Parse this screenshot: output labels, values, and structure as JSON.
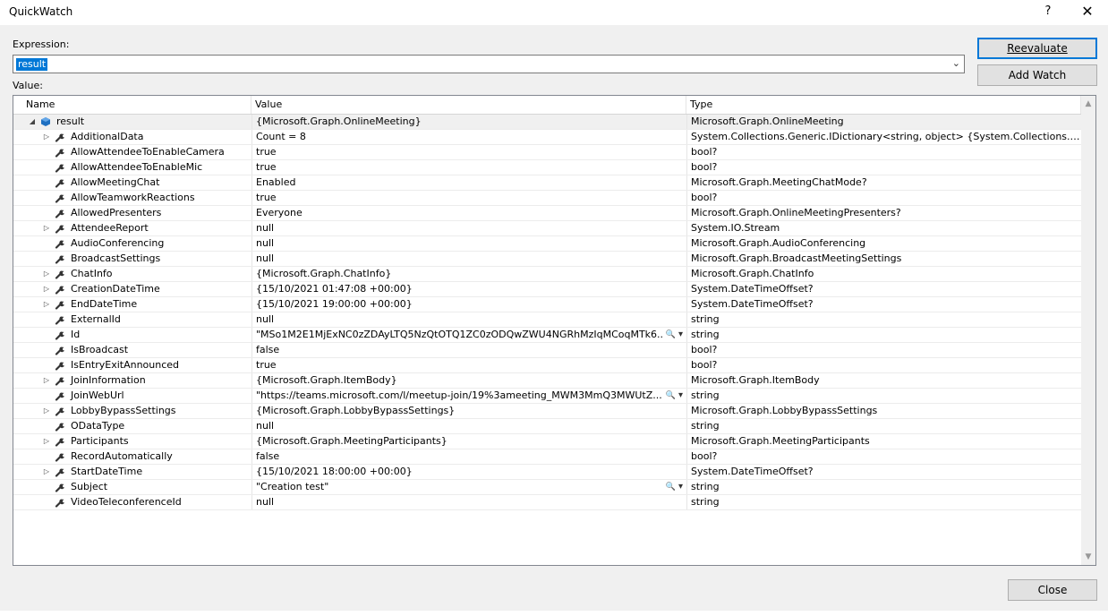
{
  "window": {
    "title": "QuickWatch",
    "help_label": "?",
    "close_label": "✕"
  },
  "expression": {
    "label": "Expression:",
    "value": "result"
  },
  "value_label": "Value:",
  "buttons": {
    "reevaluate": "Reevaluate",
    "add_watch": "Add Watch",
    "close": "Close"
  },
  "columns": {
    "name": "Name",
    "value": "Value",
    "type": "Type"
  },
  "rows": [
    {
      "name": "result",
      "value": "{Microsoft.Graph.OnlineMeeting}",
      "type": "Microsoft.Graph.OnlineMeeting",
      "expander": "collapse",
      "icon": "object-icon",
      "level": 0,
      "tools": false
    },
    {
      "name": "AdditionalData",
      "value": "Count = 8",
      "type": "System.Collections.Generic.IDictionary<string, object> {System.Collections.Gene...",
      "expander": "expand",
      "icon": "property-wrench-icon",
      "level": 1,
      "tools": false
    },
    {
      "name": "AllowAttendeeToEnableCamera",
      "value": "true",
      "type": "bool?",
      "expander": "",
      "icon": "property-wrench-icon",
      "level": 1,
      "tools": false
    },
    {
      "name": "AllowAttendeeToEnableMic",
      "value": "true",
      "type": "bool?",
      "expander": "",
      "icon": "property-wrench-icon",
      "level": 1,
      "tools": false
    },
    {
      "name": "AllowMeetingChat",
      "value": "Enabled",
      "type": "Microsoft.Graph.MeetingChatMode?",
      "expander": "",
      "icon": "property-wrench-icon",
      "level": 1,
      "tools": false
    },
    {
      "name": "AllowTeamworkReactions",
      "value": "true",
      "type": "bool?",
      "expander": "",
      "icon": "property-wrench-icon",
      "level": 1,
      "tools": false
    },
    {
      "name": "AllowedPresenters",
      "value": "Everyone",
      "type": "Microsoft.Graph.OnlineMeetingPresenters?",
      "expander": "",
      "icon": "property-wrench-icon",
      "level": 1,
      "tools": false
    },
    {
      "name": "AttendeeReport",
      "value": "null",
      "type": "System.IO.Stream",
      "expander": "expand",
      "icon": "property-wrench-icon",
      "level": 1,
      "tools": false
    },
    {
      "name": "AudioConferencing",
      "value": "null",
      "type": "Microsoft.Graph.AudioConferencing",
      "expander": "",
      "icon": "property-wrench-icon",
      "level": 1,
      "tools": false
    },
    {
      "name": "BroadcastSettings",
      "value": "null",
      "type": "Microsoft.Graph.BroadcastMeetingSettings",
      "expander": "",
      "icon": "property-wrench-icon",
      "level": 1,
      "tools": false
    },
    {
      "name": "ChatInfo",
      "value": "{Microsoft.Graph.ChatInfo}",
      "type": "Microsoft.Graph.ChatInfo",
      "expander": "expand",
      "icon": "property-wrench-icon",
      "level": 1,
      "tools": false
    },
    {
      "name": "CreationDateTime",
      "value": "{15/10/2021 01:47:08 +00:00}",
      "type": "System.DateTimeOffset?",
      "expander": "expand",
      "icon": "property-wrench-icon",
      "level": 1,
      "tools": false
    },
    {
      "name": "EndDateTime",
      "value": "{15/10/2021 19:00:00 +00:00}",
      "type": "System.DateTimeOffset?",
      "expander": "expand",
      "icon": "property-wrench-icon",
      "level": 1,
      "tools": false
    },
    {
      "name": "ExternalId",
      "value": "null",
      "type": "string",
      "expander": "",
      "icon": "property-wrench-icon",
      "level": 1,
      "tools": false
    },
    {
      "name": "Id",
      "value": "\"MSo1M2E1MjExNC0zZDAyLTQ5NzQtOTQ1ZC0zODQwZWU4NGRhMzIqMCoqMTk6...",
      "type": "string",
      "expander": "",
      "icon": "property-wrench-icon",
      "level": 1,
      "tools": true
    },
    {
      "name": "IsBroadcast",
      "value": "false",
      "type": "bool?",
      "expander": "",
      "icon": "property-wrench-icon",
      "level": 1,
      "tools": false
    },
    {
      "name": "IsEntryExitAnnounced",
      "value": "true",
      "type": "bool?",
      "expander": "",
      "icon": "property-wrench-icon",
      "level": 1,
      "tools": false
    },
    {
      "name": "JoinInformation",
      "value": "{Microsoft.Graph.ItemBody}",
      "type": "Microsoft.Graph.ItemBody",
      "expander": "expand",
      "icon": "property-wrench-icon",
      "level": 1,
      "tools": false
    },
    {
      "name": "JoinWebUrl",
      "value": "\"https://teams.microsoft.com/l/meetup-join/19%3ameeting_MWM3MmQ3MWUtZ...",
      "type": "string",
      "expander": "",
      "icon": "property-wrench-icon",
      "level": 1,
      "tools": true
    },
    {
      "name": "LobbyBypassSettings",
      "value": "{Microsoft.Graph.LobbyBypassSettings}",
      "type": "Microsoft.Graph.LobbyBypassSettings",
      "expander": "expand",
      "icon": "property-wrench-icon",
      "level": 1,
      "tools": false
    },
    {
      "name": "ODataType",
      "value": "null",
      "type": "string",
      "expander": "",
      "icon": "property-wrench-icon",
      "level": 1,
      "tools": false
    },
    {
      "name": "Participants",
      "value": "{Microsoft.Graph.MeetingParticipants}",
      "type": "Microsoft.Graph.MeetingParticipants",
      "expander": "expand",
      "icon": "property-wrench-icon",
      "level": 1,
      "tools": false
    },
    {
      "name": "RecordAutomatically",
      "value": "false",
      "type": "bool?",
      "expander": "",
      "icon": "property-wrench-icon",
      "level": 1,
      "tools": false
    },
    {
      "name": "StartDateTime",
      "value": "{15/10/2021 18:00:00 +00:00}",
      "type": "System.DateTimeOffset?",
      "expander": "expand",
      "icon": "property-wrench-icon",
      "level": 1,
      "tools": false
    },
    {
      "name": "Subject",
      "value": "\"Creation test\"",
      "type": "string",
      "expander": "",
      "icon": "property-wrench-icon",
      "level": 1,
      "tools": true
    },
    {
      "name": "VideoTeleconferenceId",
      "value": "null",
      "type": "string",
      "expander": "",
      "icon": "property-wrench-icon",
      "level": 1,
      "tools": false
    }
  ],
  "value_tools": {
    "search_glyph": "🔍",
    "dropdown_glyph": "▾"
  }
}
